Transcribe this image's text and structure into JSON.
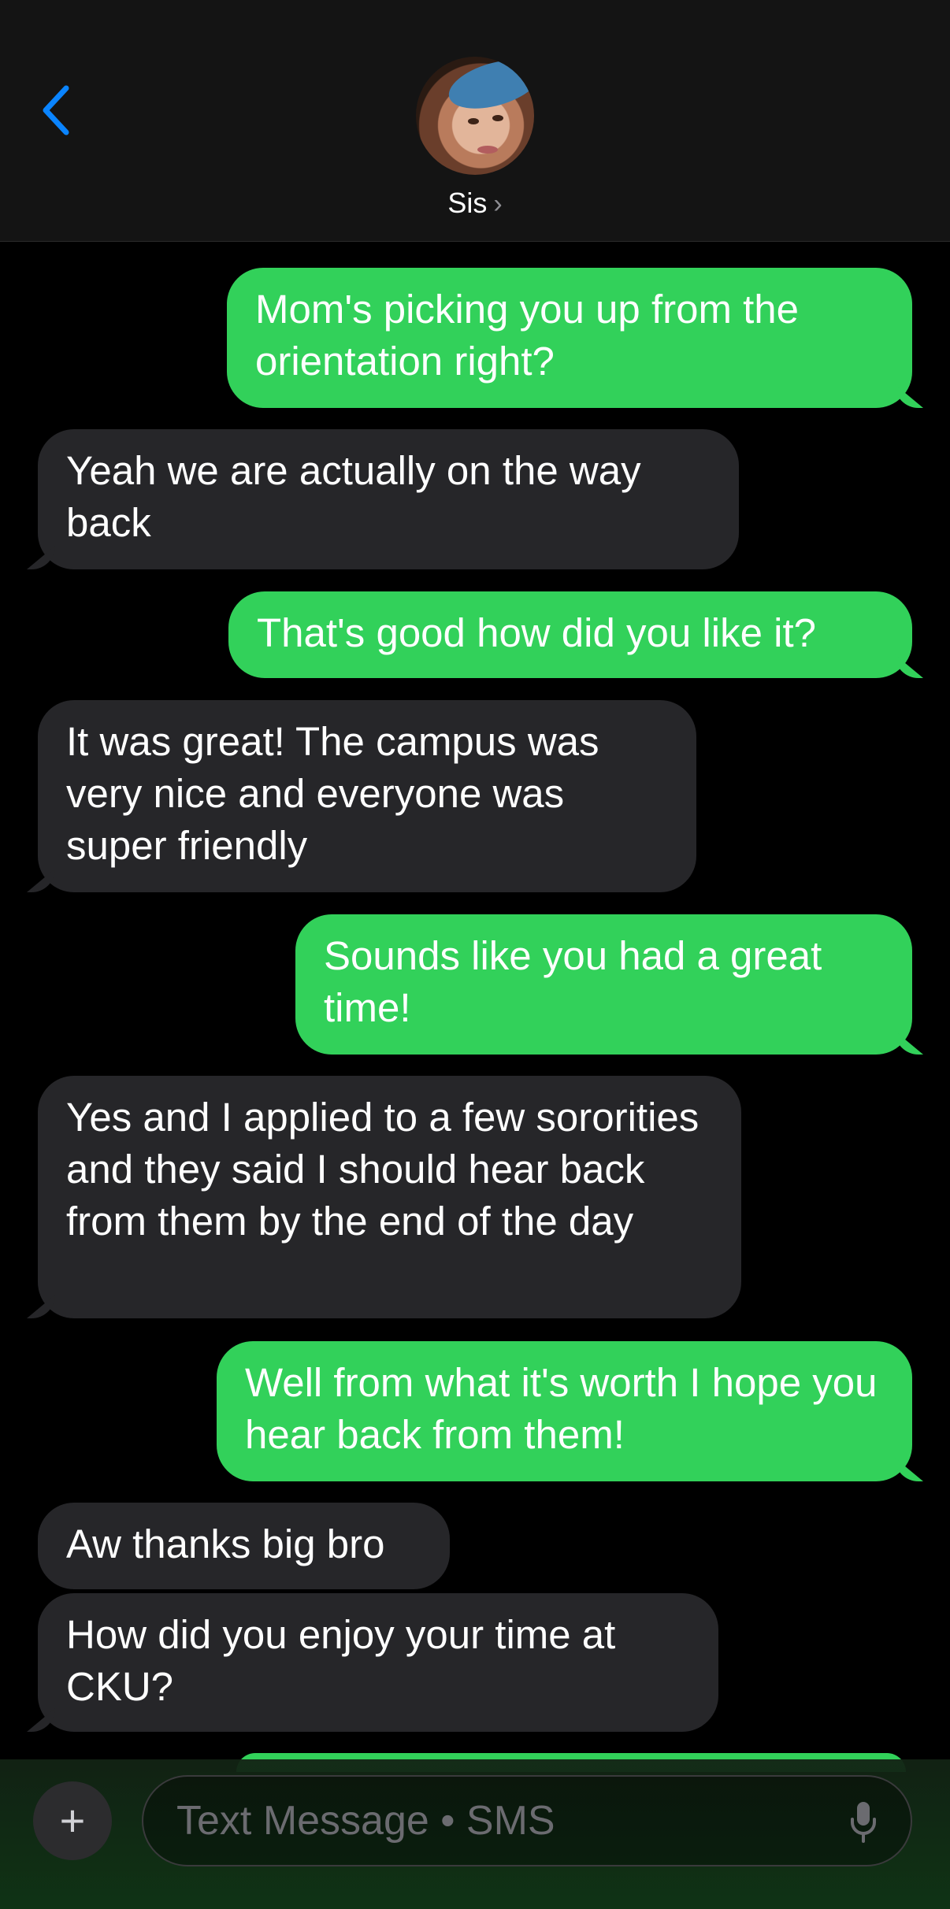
{
  "header": {
    "back_icon": "chevron-left-icon",
    "contact_name": "Sis",
    "contact_chevron": "›"
  },
  "messages": [
    {
      "side": "sent",
      "text": "Mom's picking you up from the orientation right?"
    },
    {
      "side": "received",
      "text": "Yeah we are actually on the way back"
    },
    {
      "side": "sent",
      "text": "That's good how did you like it?"
    },
    {
      "side": "received",
      "text": "It was great! The campus was very nice and everyone was super friendly"
    },
    {
      "side": "sent",
      "text": "Sounds like you had a great time!"
    },
    {
      "side": "received",
      "text": "Yes and I applied to a few sororities and they said I should hear back from them by the end of the day"
    },
    {
      "side": "sent",
      "text": "Well from what it's worth I hope you hear back from them!"
    },
    {
      "side": "received",
      "text": "Aw thanks big bro"
    },
    {
      "side": "received",
      "text": "How did you enjoy your time at CKU?"
    }
  ],
  "composer": {
    "plus_label": "+",
    "placeholder": "Text Message • SMS",
    "mic_icon": "microphone-icon"
  },
  "colors": {
    "sent_bubble": "#32d15a",
    "received_bubble": "#262629",
    "accent_blue": "#0a84ff",
    "background": "#000000"
  }
}
